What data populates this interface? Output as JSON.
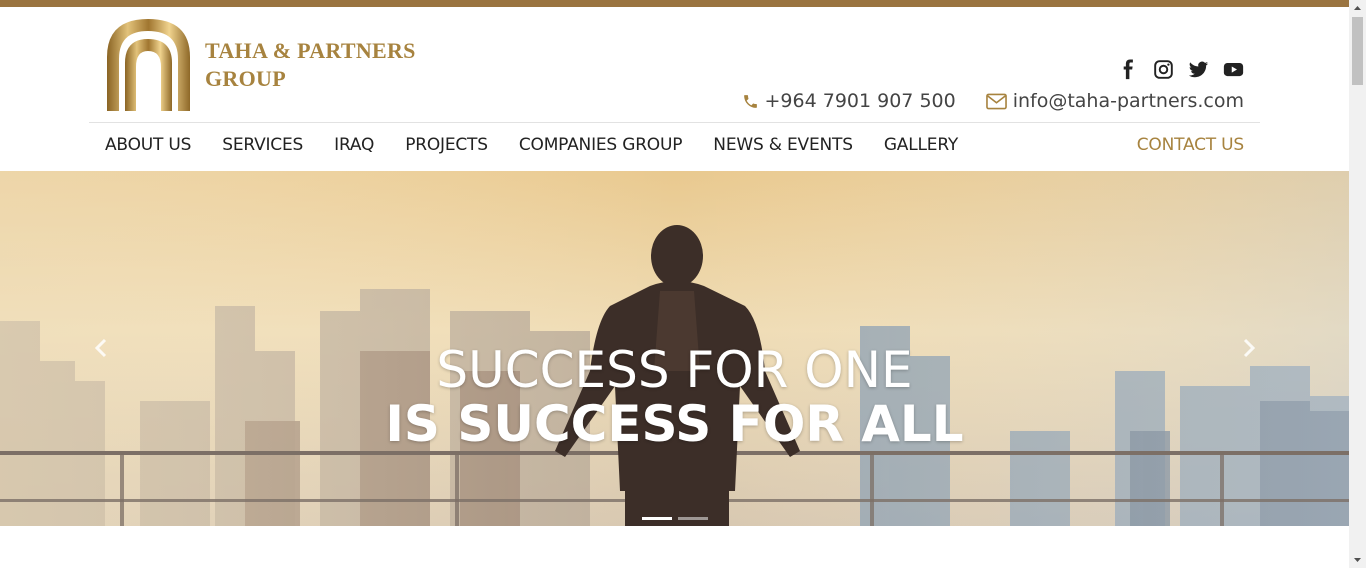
{
  "brand": {
    "name_line1": "TAHA & PARTNERS",
    "name_line2": "GROUP",
    "color": "#a7833f",
    "icon": "arch-logo-icon"
  },
  "social": [
    {
      "name": "facebook-icon"
    },
    {
      "name": "instagram-icon"
    },
    {
      "name": "twitter-icon"
    },
    {
      "name": "youtube-icon"
    }
  ],
  "contact": {
    "phone": "+964 7901 907 500",
    "email": "info@taha-partners.com",
    "phone_icon": "phone-icon",
    "email_icon": "envelope-icon"
  },
  "nav": {
    "items": [
      "ABOUT US",
      "SERVICES",
      "IRAQ",
      "PROJECTS",
      "COMPANIES GROUP",
      "NEWS & EVENTS",
      "GALLERY"
    ],
    "contact": "CONTACT US"
  },
  "hero": {
    "line1": "SUCCESS FOR ONE",
    "line2": "IS SUCCESS FOR ALL",
    "slides": 2,
    "active_slide": 1
  },
  "colors": {
    "accent": "#a7833f",
    "topbar": "#9a7440"
  }
}
